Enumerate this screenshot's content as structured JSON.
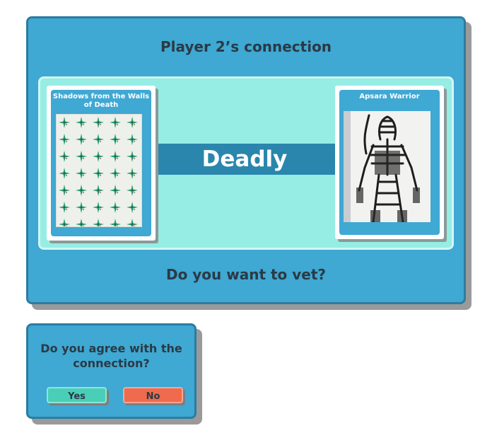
{
  "main": {
    "title": "Player 2’s connection",
    "connection_label": "Deadly",
    "vet_question": "Do you want to vet?",
    "left_card": {
      "title": "Shadows from the Walls of Death"
    },
    "right_card": {
      "title": "Apsara Warrior"
    }
  },
  "agree": {
    "question": "Do you agree with the connection?",
    "yes_label": "Yes",
    "no_label": "No"
  },
  "colors": {
    "panel": "#3fa8d3",
    "connection_area": "#96ede4",
    "connection_bar": "#2a86ad",
    "yes": "#49cfb8",
    "no": "#f06a4d"
  }
}
